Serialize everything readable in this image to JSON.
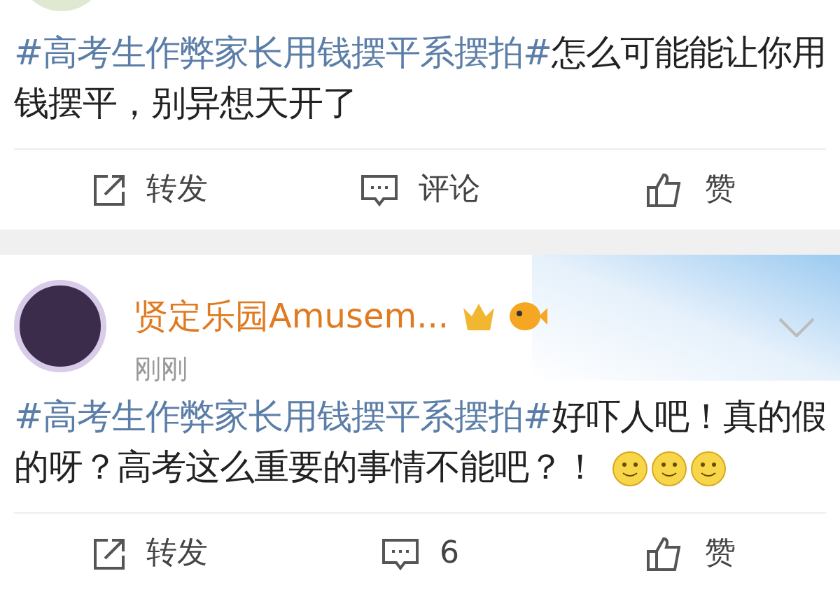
{
  "posts": [
    {
      "text": {
        "hashtag": "#高考生作弊家长用钱摆平系摆拍#",
        "body": "怎么可能能让你用钱摆平，别异想天开了"
      },
      "actions": [
        {
          "kind": "repost",
          "label": "转发"
        },
        {
          "kind": "comment",
          "label": "评论"
        },
        {
          "kind": "like",
          "label": "赞"
        }
      ]
    },
    {
      "author": {
        "name": "贤定乐园Amusem...",
        "time": "刚刚"
      },
      "text": {
        "hashtag": "#高考生作弊家长用钱摆平系摆拍#",
        "body": "好吓人吧！真的假的呀？高考这么重要的事情不能吧？！"
      },
      "emojis": [
        {
          "kind": "smile"
        },
        {
          "kind": "smile"
        },
        {
          "kind": "smile"
        }
      ],
      "actions": [
        {
          "kind": "repost",
          "label": "转发"
        },
        {
          "kind": "comment",
          "label": "6"
        },
        {
          "kind": "like",
          "label": "赞"
        }
      ]
    }
  ]
}
